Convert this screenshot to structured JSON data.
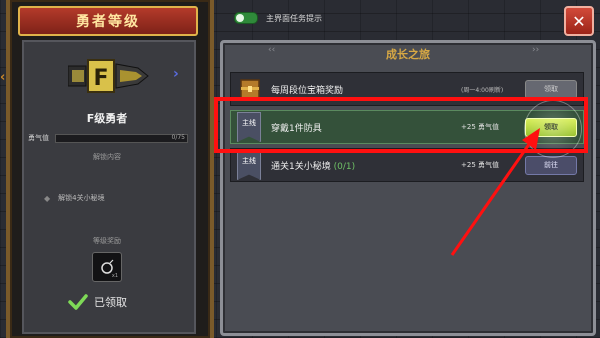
{
  "left_panel": {
    "title": "勇者等级",
    "rank_name": "F级勇者",
    "badge_letter": "F",
    "courage_label": "勇气值",
    "courage_value": "0/75",
    "courage_progress": 0,
    "unlock_header": "解锁内容",
    "unlock_item": "解锁4关小秘境",
    "reward_header": "等级奖励",
    "reward_count": "x1",
    "claimed_text": "已领取"
  },
  "top_bar": {
    "toggle_label": "主界面任务提示",
    "toggle_on": true,
    "close_icon": "close-icon"
  },
  "right_panel": {
    "title": "成长之旅",
    "tasks": [
      {
        "name": "每周段位宝箱奖励",
        "note": "(周一4:00刷新)",
        "button": "领取",
        "state": "claimed"
      },
      {
        "tag": "主线",
        "name": "穿戴1件防具",
        "reward": "+25 勇气值",
        "button": "领取",
        "state": "claim"
      },
      {
        "tag": "主线",
        "name": "通关1关小秘境",
        "progress": "(0/1)",
        "reward": "+25 勇气值",
        "button": "前往",
        "state": "go"
      }
    ]
  },
  "colors": {
    "highlight": "#ff1010",
    "accent_gold": "#d7a844",
    "claim_green": "#98c22a"
  }
}
